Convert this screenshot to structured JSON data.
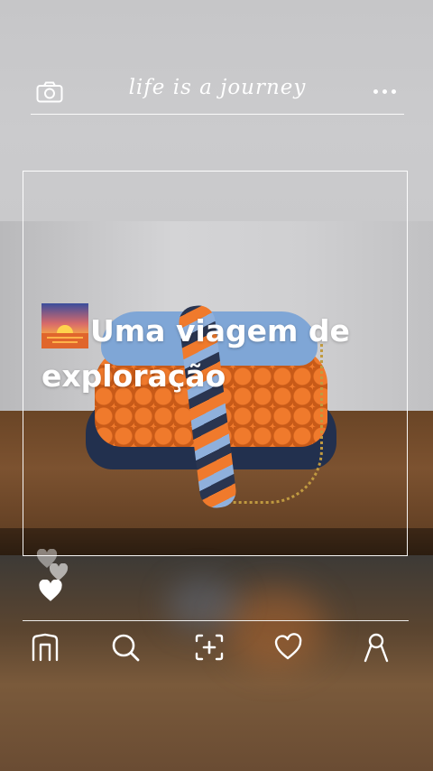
{
  "header": {
    "title": "life is a journey",
    "camera_icon": "camera-icon",
    "more_icon": "more-dots-icon"
  },
  "post": {
    "caption_emoji": "sunrise-icon",
    "caption": "Uma viagem de exploração"
  },
  "reactions": {
    "icon": "floating-hearts-icon"
  },
  "nav": {
    "items": [
      {
        "icon": "home-icon"
      },
      {
        "icon": "search-icon"
      },
      {
        "icon": "add-post-icon"
      },
      {
        "icon": "heart-icon"
      },
      {
        "icon": "profile-icon"
      }
    ]
  },
  "colors": {
    "overlay_line": "#ffffff",
    "bag_orange": "#f07a2c",
    "bag_blue": "#7fa6d6",
    "bag_navy": "#22304e",
    "table_wood": "#7c5230"
  }
}
